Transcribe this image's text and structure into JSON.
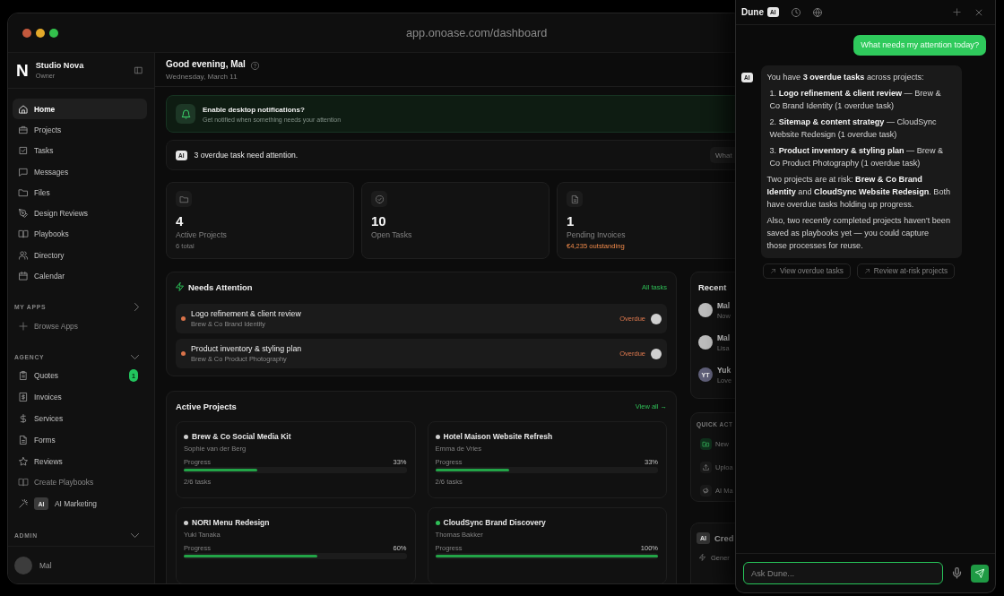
{
  "window": {
    "url": "app.onoase.com/dashboard"
  },
  "sidebar": {
    "logo": "N",
    "workspace": "Studio Nova",
    "role": "Owner",
    "nav": [
      {
        "label": "Home",
        "selected": true
      },
      {
        "label": "Projects",
        "selected": false
      },
      {
        "label": "Tasks",
        "selected": false
      },
      {
        "label": "Messages",
        "selected": false
      },
      {
        "label": "Files",
        "selected": false
      },
      {
        "label": "Design Reviews",
        "selected": false
      },
      {
        "label": "Playbooks",
        "selected": false
      },
      {
        "label": "Directory",
        "selected": false
      },
      {
        "label": "Calendar",
        "selected": false
      }
    ],
    "sections": [
      {
        "title": "MY APPS",
        "expanded": false,
        "items": [
          {
            "label": "Browse Apps",
            "kind": "action",
            "selected": false
          }
        ]
      },
      {
        "title": "AGENCY",
        "expanded": true,
        "items": [
          {
            "label": "Quotes",
            "kind": "page",
            "count": "1",
            "selected": false
          },
          {
            "label": "Invoices",
            "kind": "page",
            "selected": false
          },
          {
            "label": "Services",
            "kind": "page",
            "selected": false
          },
          {
            "label": "Forms",
            "kind": "page",
            "selected": false
          },
          {
            "label": "Reviews",
            "kind": "page",
            "selected": false
          },
          {
            "label": "Create Playbooks",
            "kind": "action",
            "selected": false
          },
          {
            "label": "AI Marketing",
            "kind": "app",
            "badge": "AI",
            "selected": false
          }
        ]
      },
      {
        "title": "ADMIN",
        "expanded": true
      }
    ],
    "user": {
      "name": "Mal"
    }
  },
  "header": {
    "greeting": "Good evening, Mal",
    "date": "Wednesday, March 11"
  },
  "notification": {
    "title": "Enable desktop notifications?",
    "text": "Get notified when something needs your attention"
  },
  "ai_summary": {
    "badge": "AI",
    "message": "3 overdue task need attention.",
    "action": "What"
  },
  "stats": [
    {
      "value": "4",
      "label": "Active Projects",
      "note": {
        "text": "6 total",
        "kind": "muted"
      }
    },
    {
      "value": "10",
      "label": "Open Tasks"
    },
    {
      "value": "1",
      "label": "Pending Invoices",
      "note": {
        "text": "€4,235 outstanding",
        "kind": "alert"
      }
    }
  ],
  "needs_attention": {
    "title": "Needs Attention",
    "link": "All tasks",
    "tasks": [
      {
        "title": "Logo refinement & client review",
        "project": "Brew & Co Brand Identity",
        "status": "Overdue",
        "kind": "overdue"
      },
      {
        "title": "Product inventory & styling plan",
        "project": "Brew & Co Product Photography",
        "status": "Overdue",
        "kind": "overdue"
      }
    ]
  },
  "active_projects": {
    "title": "Active Projects",
    "link": "View all →",
    "projects": [
      {
        "name": "Brew & Co Social Media Kit",
        "owner": "Sophie van der Berg",
        "progress_label": "Progress",
        "percent": "33%",
        "level": 0.33,
        "tasks": "2/6 tasks",
        "color": "#cfcfcf"
      },
      {
        "name": "Hotel Maison Website Refresh",
        "owner": "Emma de Vries",
        "progress_label": "Progress",
        "percent": "33%",
        "level": 0.33,
        "tasks": "2/6 tasks",
        "color": "#cfcfcf"
      },
      {
        "name": "NORI Menu Redesign",
        "owner": "Yuki Tanaka",
        "progress_label": "Progress",
        "percent": "60%",
        "level": 0.6,
        "color": "#cfcfcf"
      },
      {
        "name": "CloudSync Brand Discovery",
        "owner": "Thomas Bakker",
        "progress_label": "Progress",
        "percent": "100%",
        "level": 1,
        "color": "#2fbf57"
      }
    ]
  },
  "recent_messages": {
    "title": "Recent",
    "items": [
      {
        "name": "Mal",
        "preview": "Now"
      },
      {
        "name": "Mal",
        "preview": "Lisa"
      },
      {
        "initials": "YT",
        "name": "Yuk",
        "preview": "Love"
      }
    ]
  },
  "quick_actions": {
    "title": "QUICK ACT",
    "items": [
      {
        "label": "New",
        "primary": true
      },
      {
        "label": "Uploa",
        "primary": false
      },
      {
        "label": "AI Ma",
        "primary": false
      }
    ]
  },
  "credits": {
    "badge": "AI",
    "title": "Cred",
    "item": "Gener"
  },
  "assistant": {
    "title": "Dune",
    "badge": "AI",
    "messages": [
      {
        "kind": "user",
        "text": "What needs my attention today?"
      },
      {
        "kind": "assistant",
        "badge": "AI",
        "blocks": [
          {
            "kind": "paragraph",
            "text": "You have **3 overdue tasks** across projects:"
          },
          {
            "kind": "list_item",
            "text": "1. **Logo refinement & client review** — Brew & Co Brand Identity (1 overdue task)"
          },
          {
            "kind": "list_item",
            "text": "2. **Sitemap & content strategy** — CloudSync Website Redesign (1 overdue task)"
          },
          {
            "kind": "list_item",
            "text": "3. **Product inventory & styling plan** — Brew & Co Product Photography (1 overdue task)"
          },
          {
            "kind": "paragraph",
            "text": "Two projects are at risk: **Brew & Co Brand Identity** and **CloudSync Website Redesign**. Both have overdue tasks holding up progress."
          },
          {
            "kind": "paragraph",
            "text": "Also, two recently completed projects haven't been saved as playbooks yet — you could capture those processes for reuse."
          }
        ]
      }
    ],
    "suggestions": [
      "View overdue tasks",
      "Review at-risk projects"
    ],
    "input": {
      "placeholder": "Ask Dune..."
    }
  }
}
